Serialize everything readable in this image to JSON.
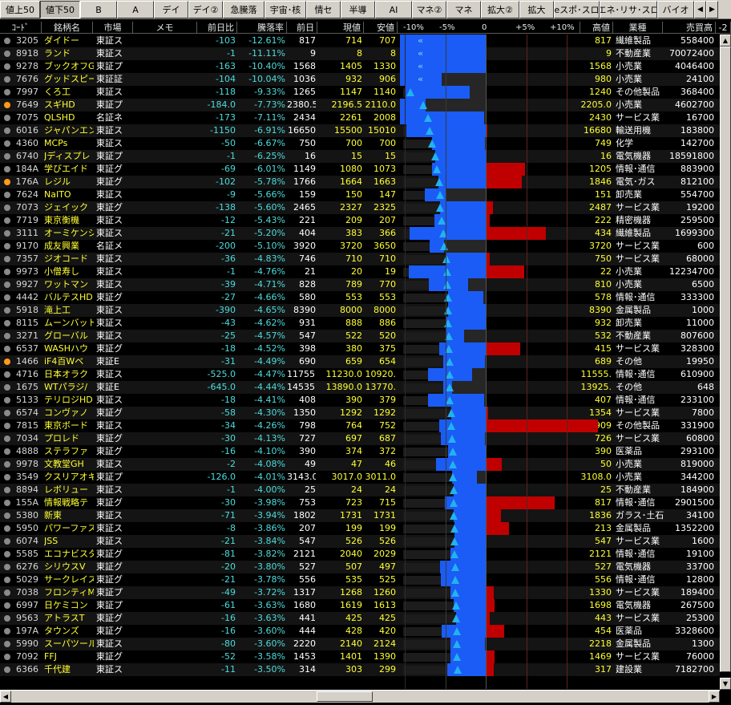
{
  "tabs": [
    "値上50",
    "値下50",
    "B",
    "A",
    "デイ",
    "デイ②",
    "急騰落",
    "宇宙･核",
    "情セ",
    "半導",
    "AI",
    "マネ②",
    "マネ",
    "拡大②",
    "拡大",
    "eスポ･スロ",
    "エネ･リサ･スロ",
    "バイオ"
  ],
  "active_tab_index": 1,
  "headers": {
    "code": "ｺｰﾄﾞ",
    "name": "銘柄名",
    "market": "市場",
    "memo": "メモ",
    "change": "前日比",
    "rate": "騰落率",
    "prev": "前日",
    "price": "現値",
    "low": "安値",
    "scale": [
      "-10%",
      "-5%",
      "0",
      "+5%",
      "+10%"
    ],
    "high": "高値",
    "sector": "業種",
    "volume": "売買高",
    "extra": "-2"
  },
  "colors": {
    "bar_negative": "#1a5cf5",
    "bar_positive": "#c00000",
    "marker": "#22b2f0",
    "name_text": "#ffff33"
  },
  "rows": [
    {
      "dot": 0,
      "code": "3205",
      "name": "ダイドー",
      "market": "東証ス",
      "change": "-103",
      "rate": "-12.61%",
      "prev": "817",
      "price": "714",
      "low": "707",
      "high": "817",
      "sector": "繊維製品",
      "volume": "558400",
      "b": [
        0,
        100
      ],
      "chev": true
    },
    {
      "dot": 0,
      "code": "8918",
      "name": "ランド",
      "market": "東証ス",
      "change": "-1",
      "rate": "-11.11%",
      "prev": "9",
      "price": "8",
      "low": "8",
      "high": "9",
      "sector": "不動産業",
      "volume": "70072400",
      "b": [
        0,
        100
      ],
      "chev": true
    },
    {
      "dot": 0,
      "code": "9278",
      "name": "ブックオフG",
      "market": "東証プ",
      "change": "-163",
      "rate": "-10.40%",
      "prev": "1568",
      "price": "1405",
      "low": "1330",
      "high": "1568",
      "sector": "小売業",
      "volume": "4046400",
      "b": [
        0,
        100
      ],
      "chev": true
    },
    {
      "dot": 0,
      "code": "7676",
      "name": "グッドスピー",
      "market": "東証証",
      "change": "-104",
      "rate": "-10.04%",
      "prev": "1036",
      "price": "932",
      "low": "906",
      "high": "980",
      "sector": "小売業",
      "volume": "24100",
      "b": [
        -5.4,
        100
      ],
      "chev": true
    },
    {
      "dot": 0,
      "code": "7997",
      "name": "くろ工",
      "market": "東証ス",
      "change": "-118",
      "rate": "-9.33%",
      "prev": "1265",
      "price": "1147",
      "low": "1140",
      "high": "1240",
      "sector": "その他製品",
      "volume": "368400",
      "b": [
        -2.0,
        100
      ]
    },
    {
      "dot": 1,
      "code": "7649",
      "name": "スギHD",
      "market": "東証プ",
      "change": "-184.0",
      "rate": "-7.73%",
      "prev": "2380.5",
      "price": "2196.5",
      "low": "2110.0",
      "high": "2205.0",
      "sector": "小売業",
      "volume": "4602700",
      "b": [
        -7.4,
        100
      ]
    },
    {
      "dot": 0,
      "code": "7075",
      "name": "QLSHD",
      "market": "名証ネ",
      "change": "-173",
      "rate": "-7.11%",
      "prev": "2434",
      "price": "2261",
      "low": "2008",
      "high": "2430",
      "sector": "サービス業",
      "volume": "16700",
      "b": [
        -0.2,
        100
      ]
    },
    {
      "dot": 0,
      "code": "6016",
      "name": "ジャパンエン",
      "market": "東証ス",
      "change": "-1150",
      "rate": "-6.91%",
      "prev": "16650",
      "price": "15500",
      "low": "15010",
      "high": "16680",
      "sector": "輸送用機",
      "volume": "183800",
      "b": [
        0.2,
        100
      ]
    },
    {
      "dot": 0,
      "code": "4360",
      "name": "MCPs",
      "market": "東証ス",
      "change": "-50",
      "rate": "-6.67%",
      "prev": "750",
      "price": "700",
      "low": "700",
      "high": "749",
      "sector": "化学",
      "volume": "142700",
      "b": [
        -0.1,
        100
      ]
    },
    {
      "dot": 0,
      "code": "6740",
      "name": "Jディスプレ",
      "market": "東証プ",
      "change": "-1",
      "rate": "-6.25%",
      "prev": "16",
      "price": "15",
      "low": "15",
      "high": "16",
      "sector": "電気機器",
      "volume": "18591800",
      "b": [
        0,
        100
      ]
    },
    {
      "dot": 0,
      "code": "184A",
      "name": "学びエイド",
      "market": "東証グ",
      "change": "-69",
      "rate": "-6.01%",
      "prev": "1149",
      "price": "1080",
      "low": "1073",
      "high": "1205",
      "sector": "情報･通信",
      "volume": "883900",
      "b": [
        4.9,
        100
      ]
    },
    {
      "dot": 1,
      "code": "176A",
      "name": "レジル",
      "market": "東証グ",
      "change": "-102",
      "rate": "-5.78%",
      "prev": "1766",
      "price": "1664",
      "low": "1663",
      "high": "1846",
      "sector": "電気･ガス",
      "volume": "812100",
      "b": [
        4.5,
        100
      ]
    },
    {
      "dot": 0,
      "code": "7624",
      "name": "NaITO",
      "market": "東証ス",
      "change": "-9",
      "rate": "-5.66%",
      "prev": "159",
      "price": "150",
      "low": "147",
      "high": "151",
      "sector": "卸売業",
      "volume": "554700",
      "b": [
        -5.0,
        100
      ]
    },
    {
      "dot": 0,
      "code": "7073",
      "name": "ジェイック",
      "market": "東証グ",
      "change": "-138",
      "rate": "-5.60%",
      "prev": "2465",
      "price": "2327",
      "low": "2325",
      "high": "2487",
      "sector": "サービス業",
      "volume": "19200",
      "b": [
        0.9,
        100
      ]
    },
    {
      "dot": 0,
      "code": "7719",
      "name": "東京衡機",
      "market": "東証ス",
      "change": "-12",
      "rate": "-5.43%",
      "prev": "221",
      "price": "209",
      "low": "207",
      "high": "222",
      "sector": "精密機器",
      "volume": "259500",
      "b": [
        0.5,
        100
      ]
    },
    {
      "dot": 0,
      "code": "3111",
      "name": "オーミケンシ",
      "market": "東証ス",
      "change": "-21",
      "rate": "-5.20%",
      "prev": "404",
      "price": "383",
      "low": "366",
      "high": "434",
      "sector": "繊維製品",
      "volume": "1699300",
      "b": [
        7.4,
        100
      ]
    },
    {
      "dot": 0,
      "code": "9170",
      "name": "成友興業",
      "market": "名証メ",
      "change": "-200",
      "rate": "-5.10%",
      "prev": "3920",
      "price": "3720",
      "low": "3650",
      "high": "3720",
      "sector": "サービス業",
      "volume": "600",
      "b": [
        -5.1,
        100
      ]
    },
    {
      "dot": 0,
      "code": "7357",
      "name": "ジオコード",
      "market": "東証ス",
      "change": "-36",
      "rate": "-4.83%",
      "prev": "746",
      "price": "710",
      "low": "710",
      "high": "750",
      "sector": "サービス業",
      "volume": "68000",
      "b": [
        0.5,
        100
      ]
    },
    {
      "dot": 0,
      "code": "9973",
      "name": "小僧寿し",
      "market": "東証ス",
      "change": "-1",
      "rate": "-4.76%",
      "prev": "21",
      "price": "20",
      "low": "19",
      "high": "22",
      "sector": "小売業",
      "volume": "12234700",
      "b": [
        4.8,
        100
      ]
    },
    {
      "dot": 0,
      "code": "9927",
      "name": "ワットマン",
      "market": "東証ス",
      "change": "-39",
      "rate": "-4.71%",
      "prev": "828",
      "price": "789",
      "low": "770",
      "high": "810",
      "sector": "小売業",
      "volume": "6500",
      "b": [
        -2.2,
        100
      ]
    },
    {
      "dot": 0,
      "code": "4442",
      "name": "バルテスHD",
      "market": "東証グ",
      "change": "-27",
      "rate": "-4.66%",
      "prev": "580",
      "price": "553",
      "low": "553",
      "high": "578",
      "sector": "情報･通信",
      "volume": "333300",
      "b": [
        -0.3,
        100
      ]
    },
    {
      "dot": 0,
      "code": "5918",
      "name": "滝上工",
      "market": "東証ス",
      "change": "-390",
      "rate": "-4.65%",
      "prev": "8390",
      "price": "8000",
      "low": "8000",
      "high": "8390",
      "sector": "金属製品",
      "volume": "1000",
      "b": [
        0,
        100
      ]
    },
    {
      "dot": 0,
      "code": "8115",
      "name": "ムーンバット",
      "market": "東証ス",
      "change": "-43",
      "rate": "-4.62%",
      "prev": "931",
      "price": "888",
      "low": "886",
      "high": "932",
      "sector": "卸売業",
      "volume": "11000",
      "b": [
        0.1,
        100
      ]
    },
    {
      "dot": 0,
      "code": "3271",
      "name": "グローバル",
      "market": "東証ス",
      "change": "-25",
      "rate": "-4.57%",
      "prev": "547",
      "price": "522",
      "low": "520",
      "high": "532",
      "sector": "不動産業",
      "volume": "807600",
      "b": [
        -2.7,
        100
      ]
    },
    {
      "dot": 0,
      "code": "6537",
      "name": "WASHハウ",
      "market": "東証グ",
      "change": "-18",
      "rate": "-4.52%",
      "prev": "398",
      "price": "380",
      "low": "375",
      "high": "415",
      "sector": "サービス業",
      "volume": "328300",
      "b": [
        4.3,
        100
      ]
    },
    {
      "dot": 1,
      "code": "1466",
      "name": "iF4百Wベ",
      "market": "東証E",
      "change": "-31",
      "rate": "-4.49%",
      "prev": "690",
      "price": "659",
      "low": "654",
      "high": "689",
      "sector": "その他",
      "volume": "19950",
      "b": [
        -0.1,
        100
      ]
    },
    {
      "dot": 0,
      "code": "4716",
      "name": "日本オラク",
      "market": "東証ス",
      "change": "-525.0",
      "rate": "-4.47%",
      "prev": "11755.",
      "price": "11230.0",
      "low": "10920.",
      "high": "11555.",
      "sector": "情報･通信",
      "volume": "610900",
      "b": [
        -1.7,
        100
      ]
    },
    {
      "dot": 0,
      "code": "1675",
      "name": "WTパラジ/",
      "market": "東証E",
      "change": "-645.0",
      "rate": "-4.44%",
      "prev": "14535.",
      "price": "13890.0",
      "low": "13770.",
      "high": "13925.",
      "sector": "その他",
      "volume": "648",
      "b": [
        -4.2,
        100
      ]
    },
    {
      "dot": 0,
      "code": "5133",
      "name": "テリロジHD",
      "market": "東証ス",
      "change": "-18",
      "rate": "-4.41%",
      "prev": "408",
      "price": "390",
      "low": "379",
      "high": "407",
      "sector": "情報･通信",
      "volume": "233100",
      "b": [
        -0.2,
        100
      ]
    },
    {
      "dot": 0,
      "code": "6574",
      "name": "コンヴァノ",
      "market": "東証グ",
      "change": "-58",
      "rate": "-4.30%",
      "prev": "1350",
      "price": "1292",
      "low": "1292",
      "high": "1354",
      "sector": "サービス業",
      "volume": "7800",
      "b": [
        0.3,
        100
      ]
    },
    {
      "dot": 0,
      "code": "7815",
      "name": "東京ボード",
      "market": "東証ス",
      "change": "-34",
      "rate": "-4.26%",
      "prev": "798",
      "price": "764",
      "low": "752",
      "high": "909",
      "sector": "その他製品",
      "volume": "331900",
      "b": [
        13.9,
        100
      ]
    },
    {
      "dot": 0,
      "code": "7034",
      "name": "プロレド",
      "market": "東証グ",
      "change": "-30",
      "rate": "-4.13%",
      "prev": "727",
      "price": "697",
      "low": "687",
      "high": "726",
      "sector": "サービス業",
      "volume": "60800",
      "b": [
        -0.1,
        100
      ]
    },
    {
      "dot": 0,
      "code": "4888",
      "name": "ステラファ",
      "market": "東証グ",
      "change": "-16",
      "rate": "-4.10%",
      "prev": "390",
      "price": "374",
      "low": "372",
      "high": "390",
      "sector": "医薬品",
      "volume": "293100",
      "b": [
        0,
        100
      ]
    },
    {
      "dot": 0,
      "code": "9978",
      "name": "文教堂GH",
      "market": "東証ス",
      "change": "-2",
      "rate": "-4.08%",
      "prev": "49",
      "price": "47",
      "low": "46",
      "high": "50",
      "sector": "小売業",
      "volume": "819000",
      "b": [
        2.0,
        100
      ]
    },
    {
      "dot": 0,
      "code": "3549",
      "name": "クスリアオキ",
      "market": "東証プ",
      "change": "-126.0",
      "rate": "-4.01%",
      "prev": "3143.0",
      "price": "3017.0",
      "low": "3011.0",
      "high": "3108.0",
      "sector": "小売業",
      "volume": "344200",
      "b": [
        -1.1,
        100
      ]
    },
    {
      "dot": 0,
      "code": "8894",
      "name": "レボリュー",
      "market": "東証ス",
      "change": "-1",
      "rate": "-4.00%",
      "prev": "25",
      "price": "24",
      "low": "24",
      "high": "25",
      "sector": "不動産業",
      "volume": "184900",
      "b": [
        0,
        100
      ]
    },
    {
      "dot": 0,
      "code": "155A",
      "name": "情報戦略テ",
      "market": "東証グ",
      "change": "-30",
      "rate": "-3.98%",
      "prev": "753",
      "price": "723",
      "low": "715",
      "high": "817",
      "sector": "情報･通信",
      "volume": "2901500",
      "b": [
        8.5,
        100
      ]
    },
    {
      "dot": 0,
      "code": "5380",
      "name": "新東",
      "market": "東証ス",
      "change": "-71",
      "rate": "-3.94%",
      "prev": "1802",
      "price": "1731",
      "low": "1731",
      "high": "1836",
      "sector": "ガラス･土石",
      "volume": "34100",
      "b": [
        1.9,
        100
      ]
    },
    {
      "dot": 0,
      "code": "5950",
      "name": "パワーファス",
      "market": "東証ス",
      "change": "-8",
      "rate": "-3.86%",
      "prev": "207",
      "price": "199",
      "low": "199",
      "high": "213",
      "sector": "金属製品",
      "volume": "1352200",
      "b": [
        2.9,
        100
      ]
    },
    {
      "dot": 0,
      "code": "6074",
      "name": "JSS",
      "market": "東証ス",
      "change": "-21",
      "rate": "-3.84%",
      "prev": "547",
      "price": "526",
      "low": "526",
      "high": "547",
      "sector": "サービス業",
      "volume": "1600",
      "b": [
        0,
        100
      ]
    },
    {
      "dot": 0,
      "code": "5585",
      "name": "エコナビスタ",
      "market": "東証グ",
      "change": "-81",
      "rate": "-3.82%",
      "prev": "2121",
      "price": "2040",
      "low": "2029",
      "high": "2121",
      "sector": "情報･通信",
      "volume": "19100",
      "b": [
        0,
        100
      ]
    },
    {
      "dot": 0,
      "code": "6276",
      "name": "シリウスV",
      "market": "東証グ",
      "change": "-20",
      "rate": "-3.80%",
      "prev": "527",
      "price": "507",
      "low": "497",
      "high": "527",
      "sector": "電気機器",
      "volume": "33700",
      "b": [
        0,
        100
      ]
    },
    {
      "dot": 0,
      "code": "5029",
      "name": "サークレイス",
      "market": "東証グ",
      "change": "-21",
      "rate": "-3.78%",
      "prev": "556",
      "price": "535",
      "low": "525",
      "high": "556",
      "sector": "情報･通信",
      "volume": "12800",
      "b": [
        0,
        100
      ]
    },
    {
      "dot": 0,
      "code": "7038",
      "name": "フロンティM",
      "market": "東証プ",
      "change": "-49",
      "rate": "-3.72%",
      "prev": "1317",
      "price": "1268",
      "low": "1260",
      "high": "1330",
      "sector": "サービス業",
      "volume": "189400",
      "b": [
        1.0,
        100
      ]
    },
    {
      "dot": 0,
      "code": "6997",
      "name": "日ケミコン",
      "market": "東証プ",
      "change": "-61",
      "rate": "-3.63%",
      "prev": "1680",
      "price": "1619",
      "low": "1613",
      "high": "1698",
      "sector": "電気機器",
      "volume": "267500",
      "b": [
        1.1,
        100
      ]
    },
    {
      "dot": 0,
      "code": "9563",
      "name": "アトラスT",
      "market": "東証グ",
      "change": "-16",
      "rate": "-3.63%",
      "prev": "441",
      "price": "425",
      "low": "425",
      "high": "443",
      "sector": "サービス業",
      "volume": "25300",
      "b": [
        0.5,
        100
      ]
    },
    {
      "dot": 0,
      "code": "197A",
      "name": "タウンズ",
      "market": "東証グ",
      "change": "-16",
      "rate": "-3.60%",
      "prev": "444",
      "price": "428",
      "low": "420",
      "high": "454",
      "sector": "医薬品",
      "volume": "3328600",
      "b": [
        2.3,
        100
      ]
    },
    {
      "dot": 0,
      "code": "5990",
      "name": "スーパツール",
      "market": "東証ス",
      "change": "-80",
      "rate": "-3.60%",
      "prev": "2220",
      "price": "2140",
      "low": "2124",
      "high": "2218",
      "sector": "金属製品",
      "volume": "1300",
      "b": [
        -0.1,
        100
      ]
    },
    {
      "dot": 0,
      "code": "7092",
      "name": "FFJ",
      "market": "東証グ",
      "change": "-52",
      "rate": "-3.58%",
      "prev": "1453",
      "price": "1401",
      "low": "1390",
      "high": "1469",
      "sector": "サービス業",
      "volume": "76000",
      "b": [
        1.1,
        100
      ]
    },
    {
      "dot": 0,
      "code": "6366",
      "name": "千代建",
      "market": "東証ス",
      "change": "-11",
      "rate": "-3.50%",
      "prev": "314",
      "price": "303",
      "low": "299",
      "high": "317",
      "sector": "建設業",
      "volume": "7182700",
      "b": [
        1.0,
        100
      ]
    }
  ]
}
